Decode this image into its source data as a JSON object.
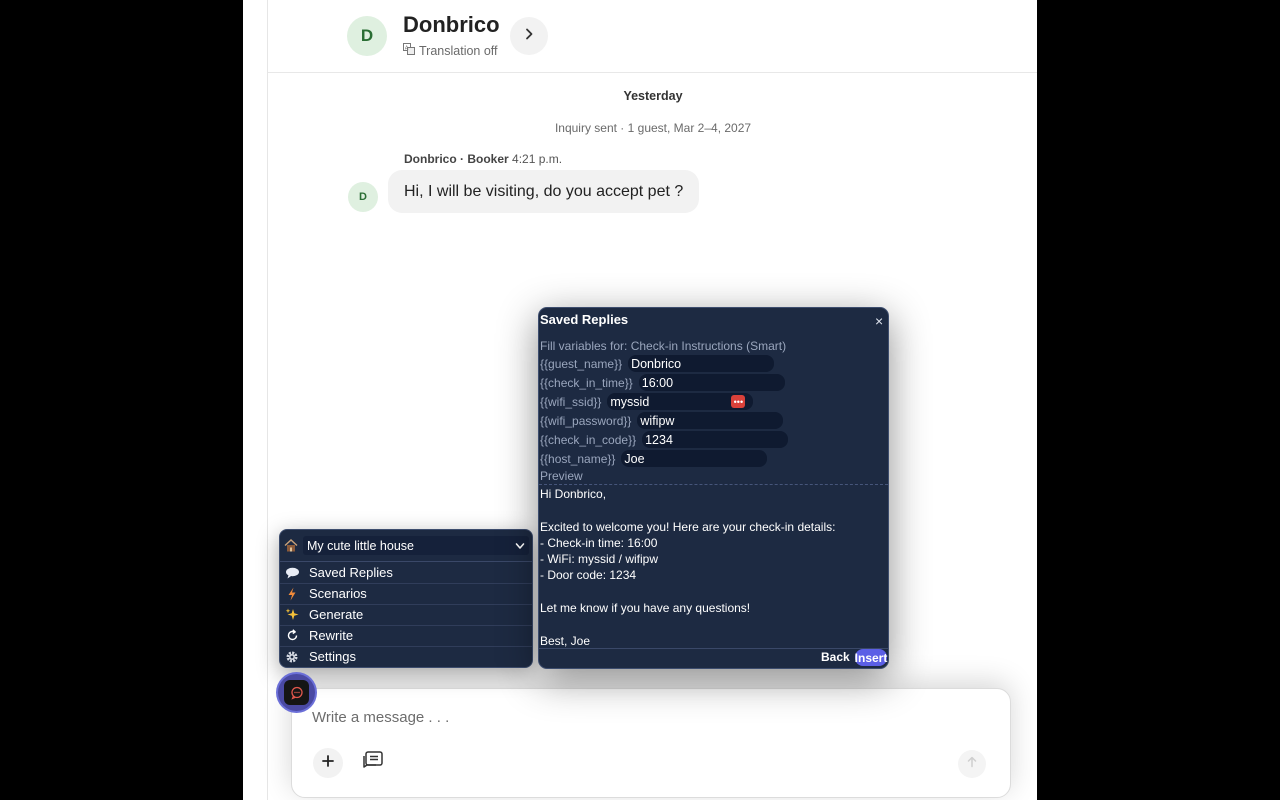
{
  "conversation": {
    "avatar_initial": "D",
    "title": "Donbrico",
    "translation_status": "Translation off",
    "date_separator": "Yesterday",
    "inquiry_text": "Inquiry sent · 1 guest, Mar 2–4, 2027",
    "message": {
      "sender": "Donbrico · Booker",
      "time": "4:21 p.m.",
      "avatar_initial": "D",
      "text": "Hi, I will be visiting, do you accept pet ?"
    }
  },
  "composer": {
    "placeholder": "Write a message . . ."
  },
  "extension_menu": {
    "property": "My cute little house",
    "items": [
      {
        "label": "Saved Replies",
        "icon": "speech-bubble-icon"
      },
      {
        "label": "Scenarios",
        "icon": "lightning-icon"
      },
      {
        "label": "Generate",
        "icon": "sparkles-icon"
      },
      {
        "label": "Rewrite",
        "icon": "refresh-icon"
      },
      {
        "label": "Settings",
        "icon": "gear-icon"
      }
    ]
  },
  "saved_replies": {
    "title": "Saved Replies",
    "close": "×",
    "fill_label": "Fill variables for: Check-in Instructions (Smart)",
    "variables": [
      {
        "name": "{{guest_name}}",
        "value": "Donbrico"
      },
      {
        "name": "{{check_in_time}}",
        "value": "16:00"
      },
      {
        "name": "{{wifi_ssid}}",
        "value": "myssid"
      },
      {
        "name": "{{wifi_password}}",
        "value": "wifipw"
      },
      {
        "name": "{{check_in_code}}",
        "value": "1234"
      },
      {
        "name": "{{host_name}}",
        "value": "Joe"
      }
    ],
    "preview_label": "Preview",
    "preview_text": "Hi Donbrico,\n\nExcited to welcome you! Here are your check-in details:\n- Check-in time: 16:00\n- WiFi: myssid / wifipw\n- Door code: 1234\n\nLet me know if you have any questions!\n\nBest, Joe",
    "back_label": "Back",
    "insert_label": "Insert"
  },
  "colors": {
    "extension_bg": "#1d2a42",
    "accent": "#5b5fe6",
    "avatar_bg": "#dff0e0"
  }
}
